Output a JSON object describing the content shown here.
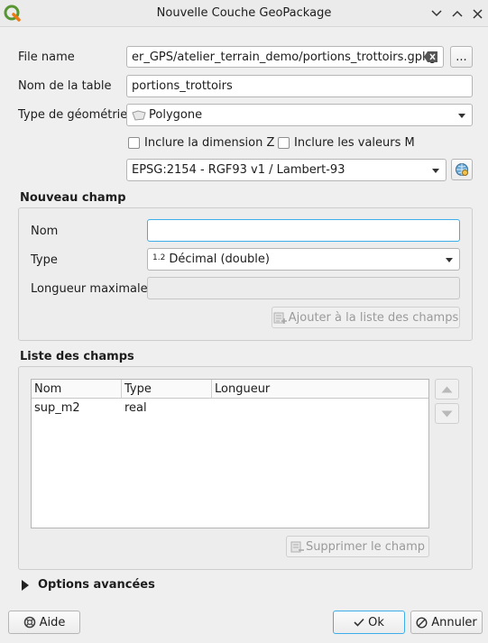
{
  "window": {
    "title": "Nouvelle Couche GeoPackage"
  },
  "form": {
    "file_name_label": "File name",
    "file_name_value": "er_GPS/atelier_terrain_demo/portions_trottoirs.gpkg",
    "browse_label": "...",
    "table_name_label": "Nom de la table",
    "table_name_value": "portions_trottoirs",
    "geometry_type_label": "Type de géométrie",
    "geometry_type_value": "Polygone",
    "include_z_label": "Inclure la dimension Z",
    "include_m_label": "Inclure les valeurs M",
    "crs_value": "EPSG:2154 - RGF93 v1 / Lambert-93"
  },
  "new_field": {
    "heading": "Nouveau champ",
    "name_label": "Nom",
    "name_value": "",
    "type_label": "Type",
    "type_icon_text": "1.2",
    "type_value": "Décimal (double)",
    "max_length_label": "Longueur maximale",
    "max_length_value": "",
    "add_button_label": "Ajouter à la liste des champs"
  },
  "fields_list": {
    "heading": "Liste des champs",
    "columns": [
      "Nom",
      "Type",
      "Longueur"
    ],
    "rows": [
      {
        "name": "sup_m2",
        "type": "real",
        "length": ""
      }
    ],
    "remove_button_label": "Supprimer le champ"
  },
  "advanced": {
    "label": "Options avancées"
  },
  "footer": {
    "help_label": "Aide",
    "ok_label": "Ok",
    "cancel_label": "Annuler"
  },
  "colors": {
    "focus": "#3daee9",
    "qgis_green": "#589632"
  }
}
